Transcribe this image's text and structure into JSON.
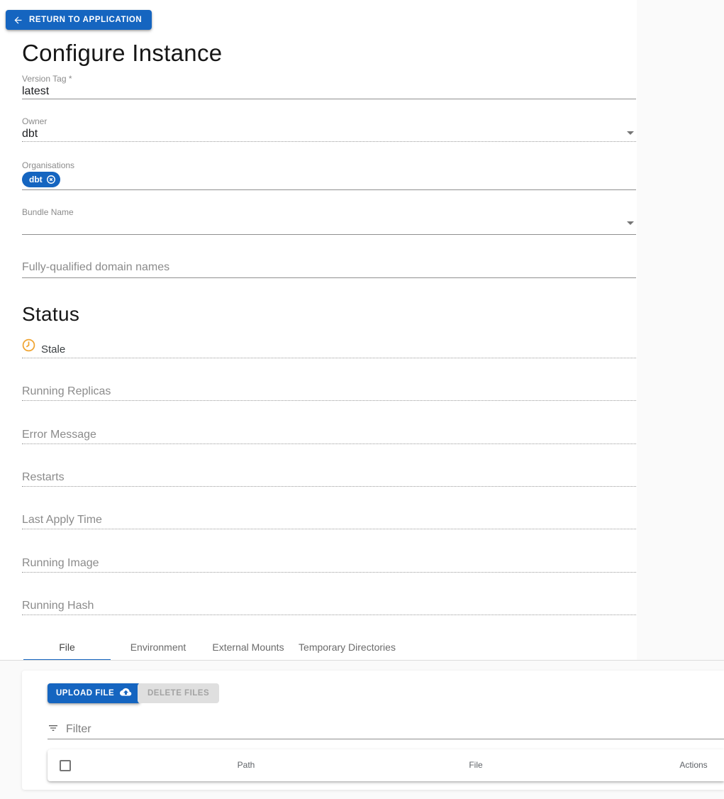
{
  "toolbar": {
    "return_label": "RETURN TO APPLICATION"
  },
  "page": {
    "title": "Configure Instance"
  },
  "form": {
    "version_tag": {
      "label": "Version Tag *",
      "value": "latest"
    },
    "owner": {
      "label": "Owner",
      "value": "dbt"
    },
    "organisations": {
      "label": "Organisations",
      "chips": [
        {
          "label": "dbt"
        }
      ]
    },
    "bundle_name": {
      "label": "Bundle Name",
      "value": ""
    },
    "fqdn": {
      "label": "Fully-qualified domain names",
      "value": ""
    }
  },
  "status": {
    "heading": "Status",
    "state_label": "Stale",
    "state_icon": "clock-icon",
    "fields": [
      {
        "label": "Running Replicas",
        "value": ""
      },
      {
        "label": "Error Message",
        "value": ""
      },
      {
        "label": "Restarts",
        "value": ""
      },
      {
        "label": "Last Apply Time",
        "value": ""
      },
      {
        "label": "Running Image",
        "value": ""
      },
      {
        "label": "Running Hash",
        "value": ""
      }
    ]
  },
  "tabs": [
    {
      "label": "File",
      "active": true
    },
    {
      "label": "Environment",
      "active": false
    },
    {
      "label": "External Mounts",
      "active": false
    },
    {
      "label": "Temporary Directories",
      "active": false
    }
  ],
  "file_panel": {
    "upload_label": "UPLOAD FILE",
    "delete_label": "DELETE FILES",
    "filter_placeholder": "Filter",
    "table": {
      "columns": [
        "Path",
        "File",
        "Actions"
      ],
      "rows": []
    }
  },
  "colors": {
    "primary": "#1565c0",
    "warning": "#f0a431",
    "page_background": "#fafafa"
  }
}
